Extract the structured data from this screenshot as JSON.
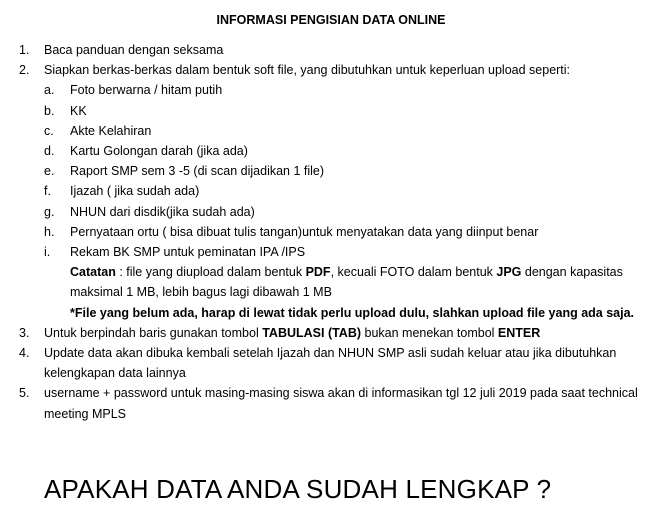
{
  "title": "INFORMASI PENGISIAN DATA ONLINE",
  "items": [
    {
      "num": "1.",
      "text": "Baca panduan dengan seksama"
    },
    {
      "num": "2.",
      "text": "Siapkan berkas-berkas dalam bentuk soft file, yang dibutuhkan untuk keperluan upload seperti:"
    },
    {
      "num": "3.",
      "pre": "Untuk berpindah baris gunakan tombol ",
      "bold1": "TABULASI (TAB)",
      "mid": " bukan menekan tombol ",
      "bold2": "ENTER"
    },
    {
      "num": "4.",
      "text": "Update  data akan dibuka kembali setelah Ijazah dan NHUN SMP asli sudah keluar atau jika dibutuhkan kelengkapan data lainnya"
    },
    {
      "num": "5.",
      "text": "username + password untuk masing-masing siswa akan di informasikan tgl 12 juli 2019 pada saat technical meeting MPLS"
    }
  ],
  "subitems": [
    {
      "letter": "a.",
      "text": "Foto berwarna / hitam putih"
    },
    {
      "letter": "b.",
      "text": "KK"
    },
    {
      "letter": "c.",
      "text": "Akte Kelahiran"
    },
    {
      "letter": "d.",
      "text": "Kartu Golongan darah (jika ada)"
    },
    {
      "letter": "e.",
      "text": "Raport SMP sem 3 -5 (di scan dijadikan 1 file)"
    },
    {
      "letter": "f.",
      "text": "Ijazah ( jika sudah ada)"
    },
    {
      "letter": "g.",
      "text": "NHUN dari disdik(jika sudah ada)"
    },
    {
      "letter": "h.",
      "text": "Pernyataan ortu ( bisa dibuat tulis tangan)untuk menyatakan data yang diinput benar"
    },
    {
      "letter": "i.",
      "text": "Rekam BK SMP untuk peminatan IPA /IPS"
    }
  ],
  "note": {
    "label": "Catatan",
    "part1": " : file yang diupload dalam bentuk ",
    "pdf": "PDF",
    "part2": ", kecuali FOTO dalam bentuk ",
    "jpg": "JPG",
    "part3": " dengan kapasitas maksimal 1 MB, lebih bagus lagi dibawah 1 MB",
    "warning": "*File yang belum ada, harap di lewat tidak perlu upload dulu, slahkan upload file yang ada saja."
  },
  "closing": "APAKAH DATA ANDA SUDAH LENGKAP ?"
}
